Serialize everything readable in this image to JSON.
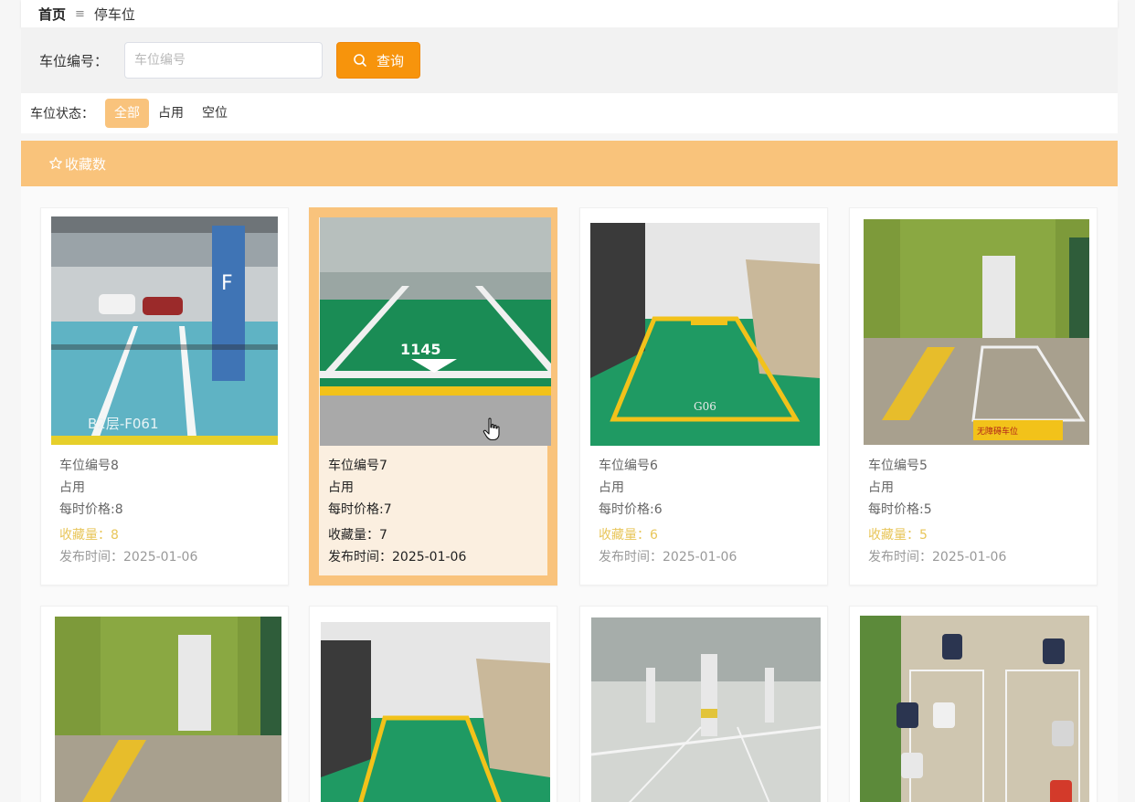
{
  "breadcrumb": {
    "home": "首页",
    "separator": "≡",
    "current": "停车位"
  },
  "search": {
    "label": "车位编号：",
    "placeholder": "车位编号",
    "value": "",
    "button_label": "查询"
  },
  "filter": {
    "label": "车位状态：",
    "options": [
      "全部",
      "占用",
      "空位"
    ],
    "selected": "全部"
  },
  "section": {
    "title": "收藏数"
  },
  "cards": [
    {
      "name": "车位编号8",
      "status": "占用",
      "price": "每时价格:8",
      "fav_label": "收藏量：",
      "fav_count": "8",
      "date_label": "发布时间：",
      "date": "2025-01-06"
    },
    {
      "name": "车位编号7",
      "status": "占用",
      "price": "每时价格:7",
      "fav_label": "收藏量：",
      "fav_count": "7",
      "date_label": "发布时间：",
      "date": "2025-01-06"
    },
    {
      "name": "车位编号6",
      "status": "占用",
      "price": "每时价格:6",
      "fav_label": "收藏量：",
      "fav_count": "6",
      "date_label": "发布时间：",
      "date": "2025-01-06"
    },
    {
      "name": "车位编号5",
      "status": "占用",
      "price": "每时价格:5",
      "fav_label": "收藏量：",
      "fav_count": "5",
      "date_label": "发布时间：",
      "date": "2025-01-06"
    }
  ],
  "photo_text": {
    "card8_floor_code": "B2层-F061",
    "card7_spot_number": "1145",
    "card6_spot_code": "G06",
    "accessible_sign": "无障碍车位"
  },
  "colors": {
    "accent_orange": "#f7940c",
    "header_orange": "#f9c37b",
    "fav_gold": "#e8c65a",
    "spot_green": "#1f9a63",
    "line_yellow": "#f2c21a"
  }
}
